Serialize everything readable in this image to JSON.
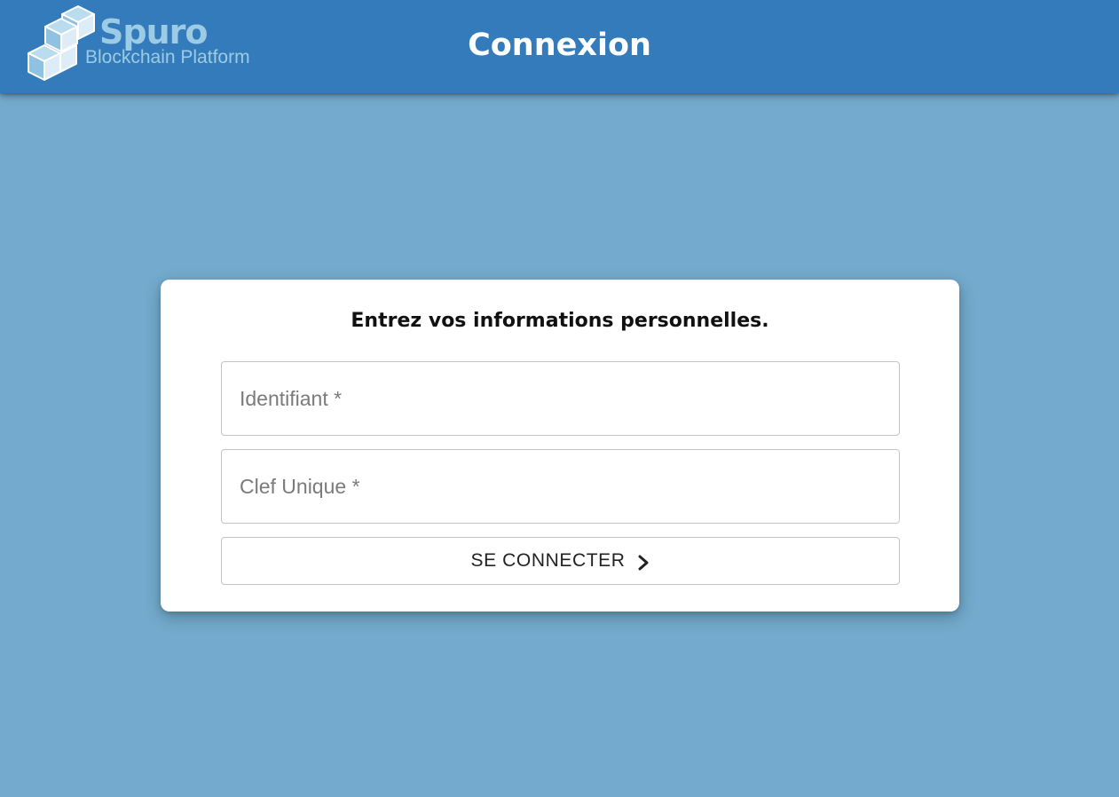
{
  "header": {
    "logo": {
      "name": "Spuro",
      "subtitle": "Blockchain Platform",
      "icon": "stacked-cubes-icon"
    },
    "title": "Connexion"
  },
  "login_form": {
    "heading": "Entrez vos informations personnelles.",
    "identifier": {
      "placeholder": "Identifiant *",
      "value": ""
    },
    "key": {
      "placeholder": "Clef Unique *",
      "value": ""
    },
    "submit": {
      "label": "SE CONNECTER",
      "icon": "chevron-right-icon"
    }
  },
  "colors": {
    "header_background": "#347bbb",
    "page_background": "#73aacd",
    "card_background": "#ffffff",
    "logo_text": "#9ccbe6"
  }
}
